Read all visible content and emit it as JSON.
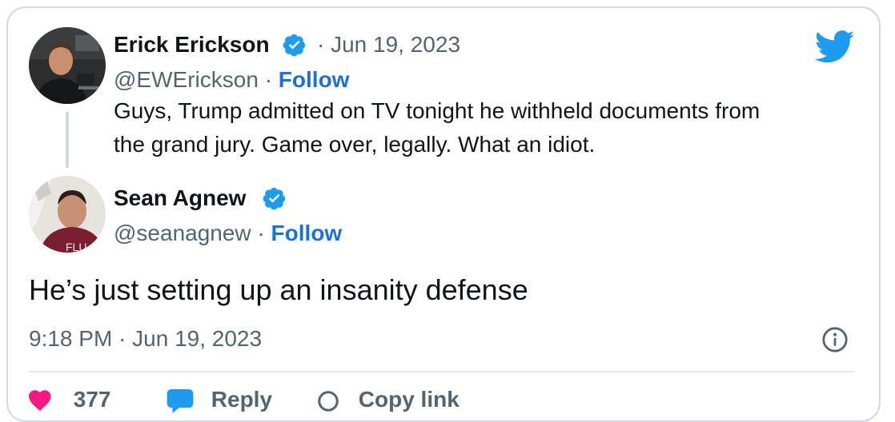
{
  "tweet_quoted": {
    "author_name": "Erick Erickson",
    "separator": "·",
    "date": "Jun 19, 2023",
    "handle": "@EWErickson",
    "follow_label": "Follow",
    "text_line1": "Guys, Trump admitted on TV tonight he withheld documents from",
    "text_line2": "the grand jury. Game over, legally. What an idiot."
  },
  "tweet_main": {
    "author_name": "Sean Agnew",
    "handle": "@seanagnew",
    "separator": "·",
    "follow_label": "Follow",
    "text": "He’s just setting up an insanity defense",
    "timestamp": "9:18 PM · Jun 19, 2023"
  },
  "actions": {
    "likes_count": "377",
    "reply_label": "Reply",
    "copy_link_label": "Copy link"
  },
  "colors": {
    "brand_blue": "#1d9bf0",
    "follow_blue": "#1d70d8",
    "muted_text": "#536471",
    "like_pink": "#f91880"
  },
  "icons": {
    "logo": "twitter-bird-icon",
    "verified": "verified-badge-icon",
    "info": "info-icon",
    "like": "heart-icon",
    "reply": "reply-bubble-icon",
    "copy": "link-icon"
  }
}
